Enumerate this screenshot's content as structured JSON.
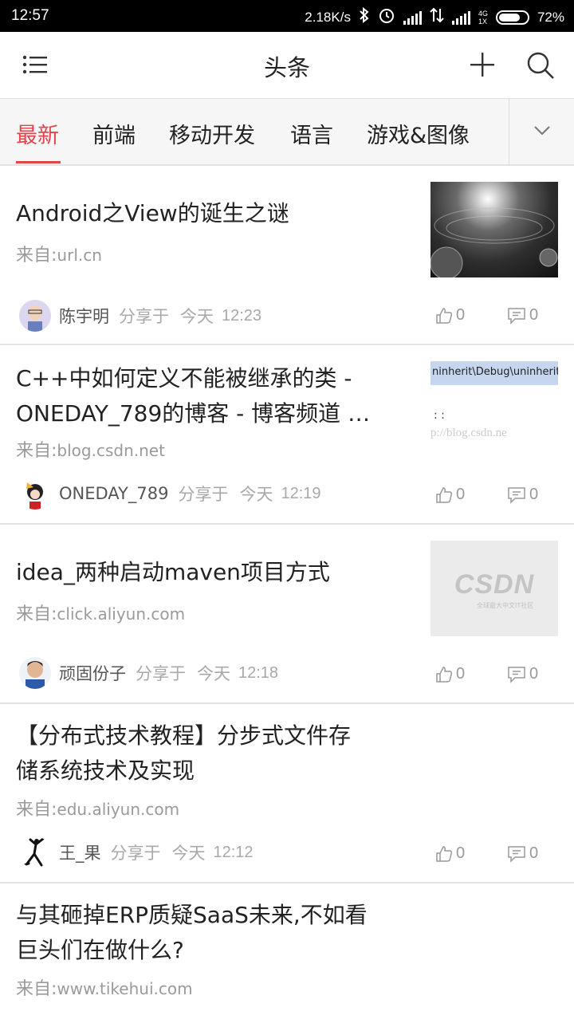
{
  "status": {
    "time": "12:57",
    "speed": "2.18K/s",
    "net_top": "4G",
    "net_bottom": "1X",
    "battery": "72%"
  },
  "header": {
    "title": "头条"
  },
  "tabs": [
    "最新",
    "前端",
    "移动开发",
    "语言",
    "游戏&图像"
  ],
  "articles": [
    {
      "title_lines": [
        "Android之View的诞生之谜"
      ],
      "src_label": "来自:",
      "source": "url.cn",
      "user": "陈宇明",
      "shared": "分享于",
      "day": "今天",
      "time": "12:23",
      "likes": "0",
      "comments": "0"
    },
    {
      "title_lines": [
        "C++中如何定义不能被继承的类 -",
        "ONEDAY_789的博客 - 博客频道 …"
      ],
      "src_label": "来自:",
      "source": "blog.csdn.net",
      "user": "ONEDAY_789",
      "shared": "分享于",
      "day": "今天",
      "time": "12:19",
      "likes": "0",
      "comments": "0",
      "thumb_text": [
        "ninherit\\Debug\\uninherit.e",
        ": :",
        "p://blog.csdn.ne"
      ]
    },
    {
      "title_lines": [
        "idea_两种启动maven项目方式"
      ],
      "src_label": "来自:",
      "source": "click.aliyun.com",
      "user": "顽固份子",
      "shared": "分享于",
      "day": "今天",
      "time": "12:18",
      "likes": "0",
      "comments": "0",
      "thumb_logo": "CSDN",
      "thumb_sub": "全球最大中文IT社区"
    },
    {
      "title_lines": [
        "【分布式技术教程】分步式文件存",
        "储系统技术及实现"
      ],
      "src_label": "来自:",
      "source": "edu.aliyun.com",
      "user": "王_果",
      "shared": "分享于",
      "day": "今天",
      "time": "12:12",
      "likes": "0",
      "comments": "0"
    },
    {
      "title_lines": [
        "与其砸掉ERP质疑SaaS未来,不如看",
        "巨头们在做什么?"
      ],
      "src_label": "来自:",
      "source": "www.tikehui.com"
    }
  ]
}
